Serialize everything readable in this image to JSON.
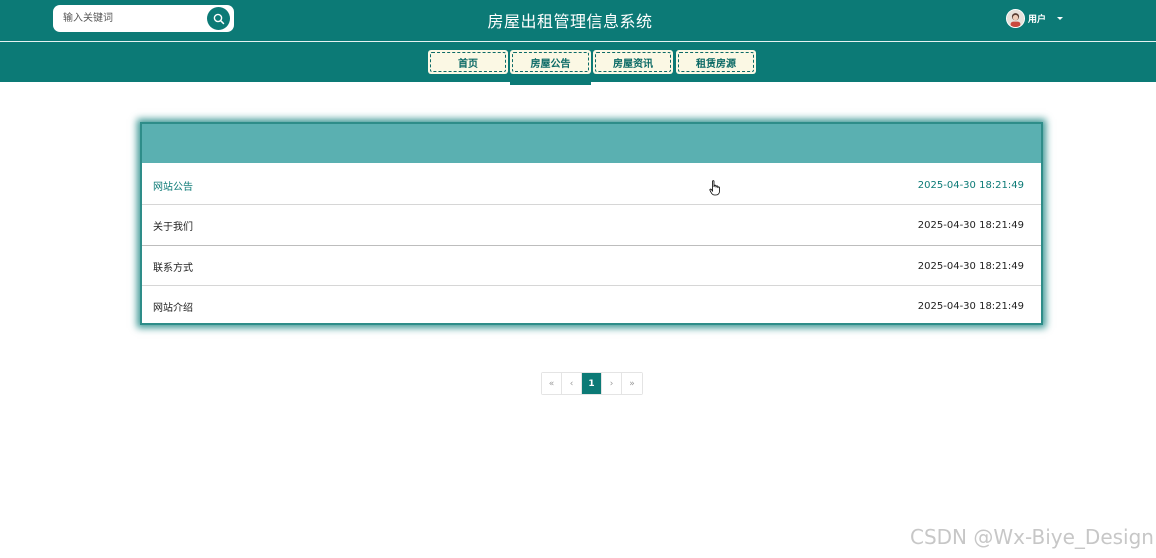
{
  "header": {
    "search_placeholder": "输入关键词",
    "site_title": "房屋出租管理信息系统",
    "user_label": "用户"
  },
  "nav": {
    "items": [
      {
        "label": "首页"
      },
      {
        "label": "房屋公告"
      },
      {
        "label": "房屋资讯"
      },
      {
        "label": "租赁房源"
      }
    ],
    "active_index": 1
  },
  "list": {
    "rows": [
      {
        "title": "网站公告",
        "date": "2025-04-30 18:21:49"
      },
      {
        "title": "关于我们",
        "date": "2025-04-30 18:21:49"
      },
      {
        "title": "联系方式",
        "date": "2025-04-30 18:21:49"
      },
      {
        "title": "网站介绍",
        "date": "2025-04-30 18:21:49"
      }
    ],
    "hovered_index": 0
  },
  "pagination": {
    "first": "«",
    "prev": "‹",
    "current": "1",
    "next": "›",
    "last": "»"
  },
  "watermark": "CSDN @Wx-Biye_Design",
  "colors": {
    "primary": "#0c7a76",
    "panel_header": "#5ab0b1",
    "nav_button_bg": "#fbf8e4"
  }
}
